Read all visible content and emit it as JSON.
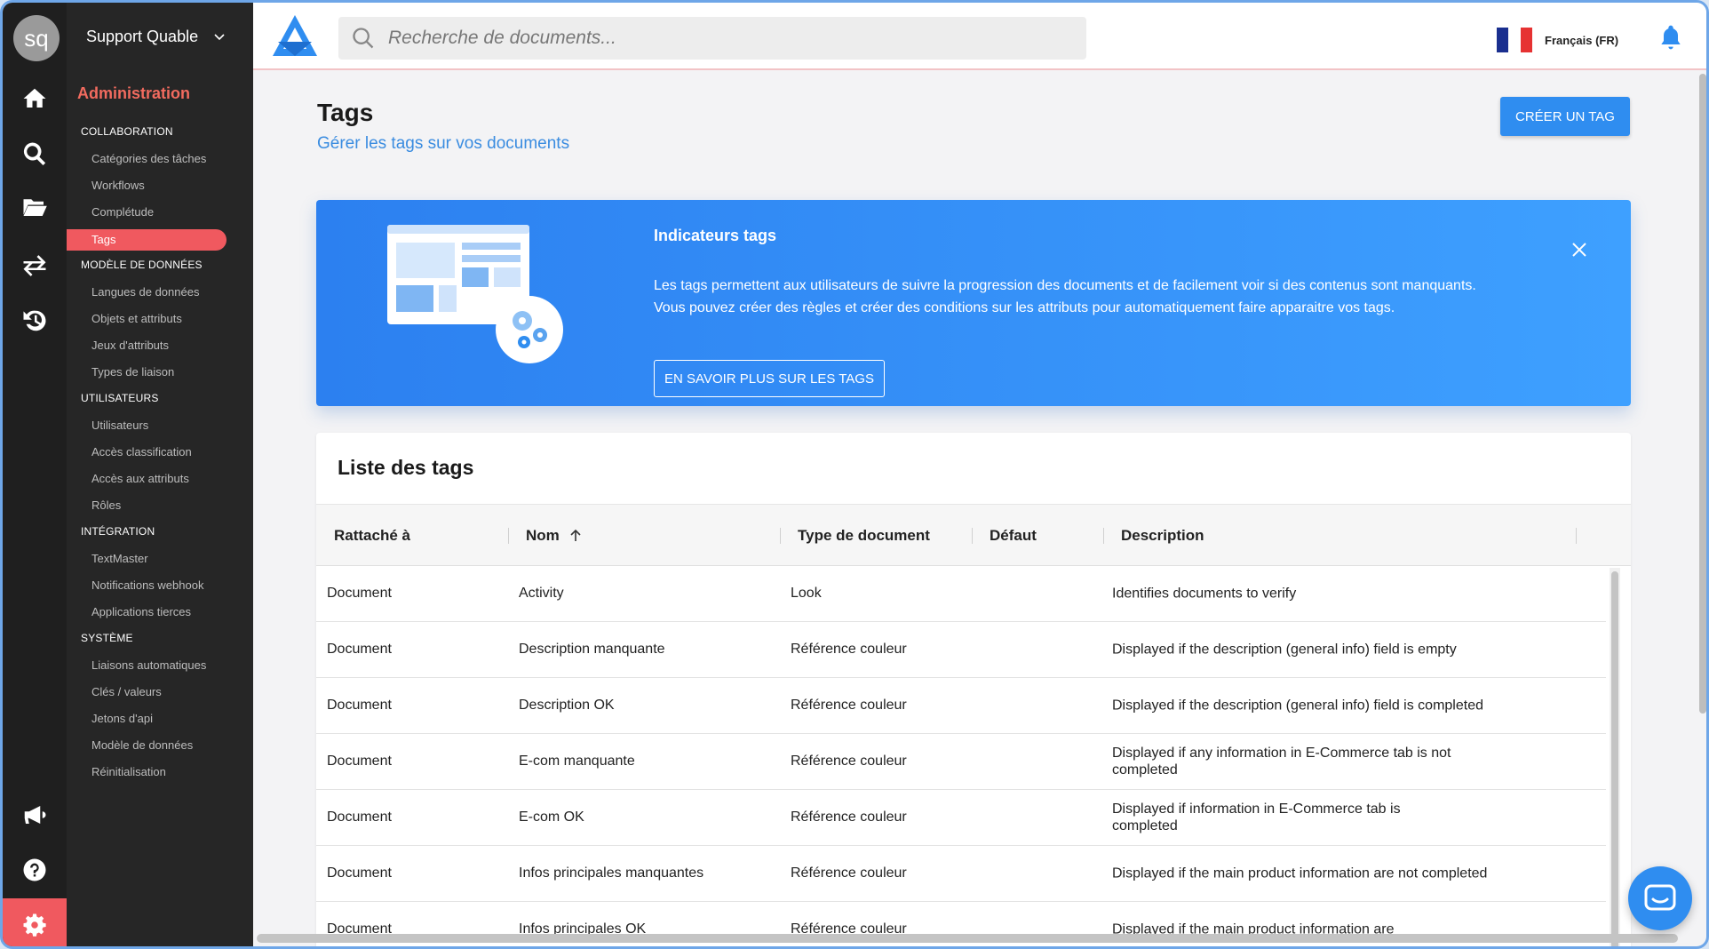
{
  "account": {
    "initials": "sq",
    "name": "Support Quable"
  },
  "menu": {
    "heading": "Administration",
    "sections": [
      {
        "label": "COLLABORATION",
        "items": [
          "Catégories des tâches",
          "Workflows",
          "Complétude",
          "Tags"
        ]
      },
      {
        "label": "MODÈLE DE DONNÉES",
        "items": [
          "Langues de données",
          "Objets et attributs",
          "Jeux d'attributs",
          "Types de liaison"
        ]
      },
      {
        "label": "UTILISATEURS",
        "items": [
          "Utilisateurs",
          "Accès classification",
          "Accès aux attributs",
          "Rôles"
        ]
      },
      {
        "label": "INTÉGRATION",
        "items": [
          "TextMaster",
          "Notifications webhook",
          "Applications tierces"
        ]
      },
      {
        "label": "SYSTÈME",
        "items": [
          "Liaisons automatiques",
          "Clés / valeurs",
          "Jetons d'api",
          "Modèle de données",
          "Réinitialisation"
        ]
      }
    ],
    "active_item": "Tags"
  },
  "rail": {
    "icons": [
      "home-icon",
      "search-icon",
      "folder-open-icon",
      "exchange-icon",
      "history-icon",
      "megaphone-icon",
      "help-icon",
      "settings-icon"
    ]
  },
  "topbar": {
    "search_placeholder": "Recherche de documents...",
    "language": "Français (FR)"
  },
  "page": {
    "title": "Tags",
    "subtitle": "Gérer les tags sur vos documents",
    "create_button": "CRÉER UN TAG"
  },
  "banner": {
    "title": "Indicateurs tags",
    "text": "Les tags permettent aux utilisateurs de suivre la progression des documents et de facilement voir si des contenus sont manquants. Vous pouvez créer des règles et créer des conditions sur les attributs pour automatiquement faire apparaitre vos tags.",
    "button": "EN SAVOIR PLUS SUR LES TAGS"
  },
  "table": {
    "title": "Liste des tags",
    "columns": [
      "Rattaché à",
      "Nom",
      "Type de document",
      "Défaut",
      "Description"
    ],
    "rows": [
      [
        "Document",
        "Activity",
        "Look",
        "",
        "Identifies documents to verify"
      ],
      [
        "Document",
        "Description manquante",
        "Référence couleur",
        "",
        "Displayed if the description (general info) field is empty"
      ],
      [
        "Document",
        "Description OK",
        "Référence couleur",
        "",
        "Displayed if the description (general info) field is completed"
      ],
      [
        "Document",
        "E-com manquante",
        "Référence couleur",
        "",
        "Displayed if any information in E-Commerce tab is not completed"
      ],
      [
        "Document",
        "E-com OK",
        "Référence couleur",
        "",
        "Displayed if information in E-Commerce tab is completed"
      ],
      [
        "Document",
        "Infos principales manquantes",
        "Référence couleur",
        "",
        "Displayed if the main product information are not completed"
      ],
      [
        "Document",
        "Infos principales OK",
        "Référence couleur",
        "",
        "Displayed if the main product information are"
      ]
    ]
  },
  "colors": {
    "accent": "#f0595f",
    "primary": "#2f8df0",
    "sidebar": "#262626",
    "rail": "#1f1f1f"
  }
}
